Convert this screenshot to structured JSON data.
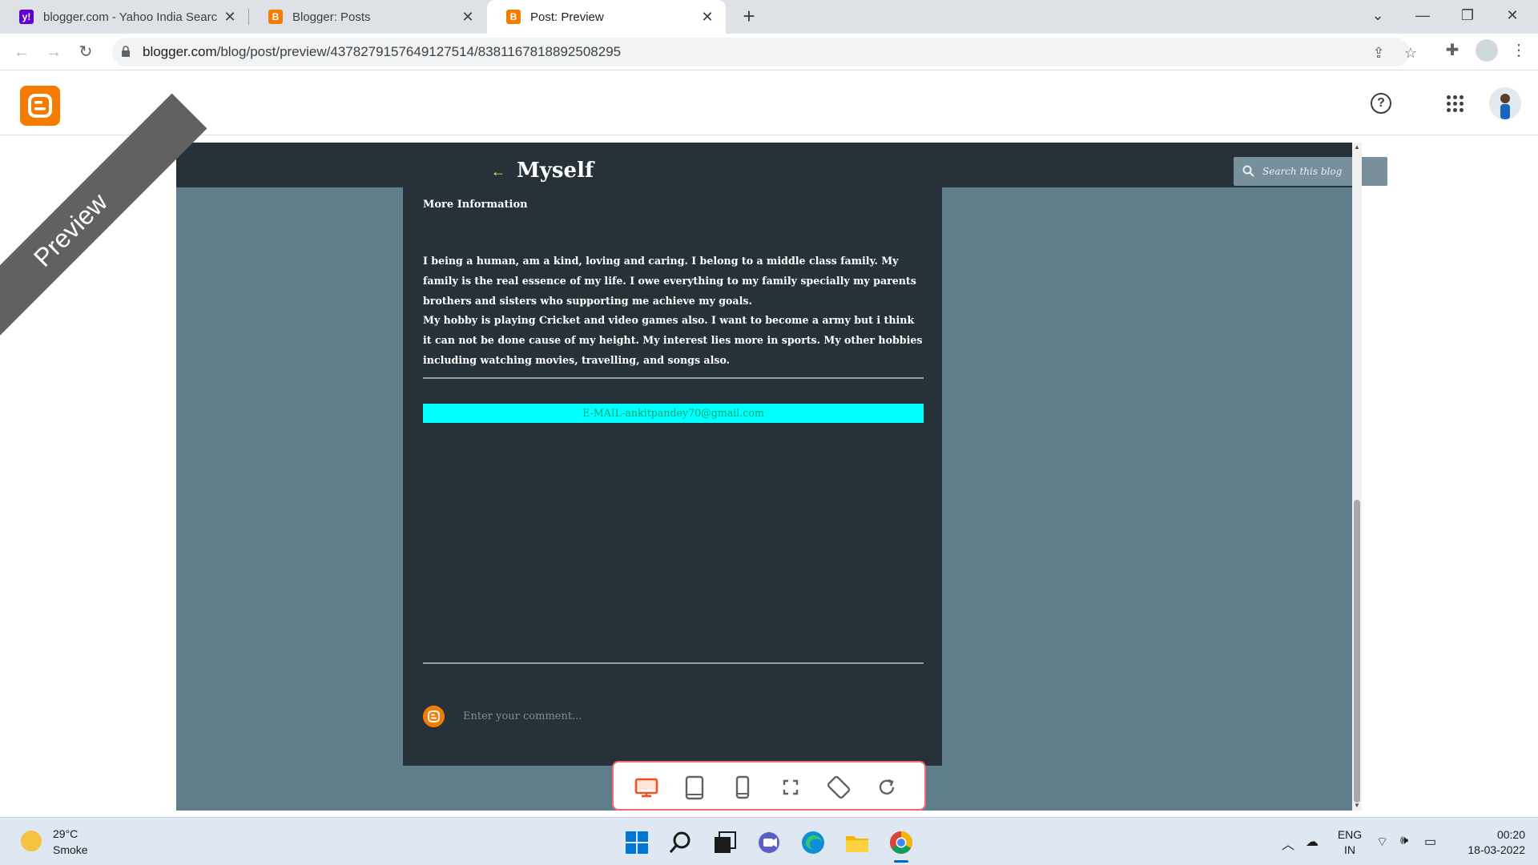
{
  "browser": {
    "tabs": [
      {
        "title": "blogger.com - Yahoo India Search Results",
        "favicon": "yahoo-icon",
        "color": "#6001d2"
      },
      {
        "title": "Blogger: Posts",
        "favicon": "blogger-icon",
        "color": "#f57c00"
      },
      {
        "title": "Post: Preview",
        "favicon": "blogger-icon",
        "color": "#f57c00",
        "active": true
      }
    ],
    "new_tab_label": "+",
    "url_host": "blogger.com",
    "url_path": "/blog/post/preview/4378279157649127514/8381167818892508295"
  },
  "blogger": {
    "brand_color": "#f57c00",
    "help_label": "?"
  },
  "blog": {
    "title": "Myself",
    "back_icon": "arrow-left-icon",
    "search_placeholder": "Search this blog",
    "post_heading": "More Information",
    "paragraph_1": "I being a human, am a kind, loving and caring. I belong to a middle class family. My family is the real essence of my life. I owe everything to my family specially my parents brothers and sisters who supporting me achieve my goals.",
    "paragraph_2": "My hobby is playing Cricket and video games also. I want to become a army but i think it can not be done cause of my height. My interest lies more in sports. My other hobbies including watching movies, travelling, and songs also.",
    "email_line": "E-MAIL-ankitpandey70@gmail.com",
    "comment_placeholder": "Enter your comment...",
    "colors": {
      "page_bg": "#607d8b",
      "post_bg": "#263238",
      "email_bar": "#00ffff",
      "email_text": "#00a86b"
    }
  },
  "preview": {
    "ribbon_label": "Preview",
    "device_buttons": [
      "desktop-icon",
      "tablet-icon",
      "phone-icon",
      "fullscreen-icon",
      "rotate-icon",
      "refresh-icon"
    ],
    "active_device": "desktop-icon"
  },
  "taskbar": {
    "temperature": "29°C",
    "weather": "Smoke",
    "lang_top": "ENG",
    "lang_bottom": "IN",
    "time": "00:20",
    "date": "18-03-2022"
  }
}
